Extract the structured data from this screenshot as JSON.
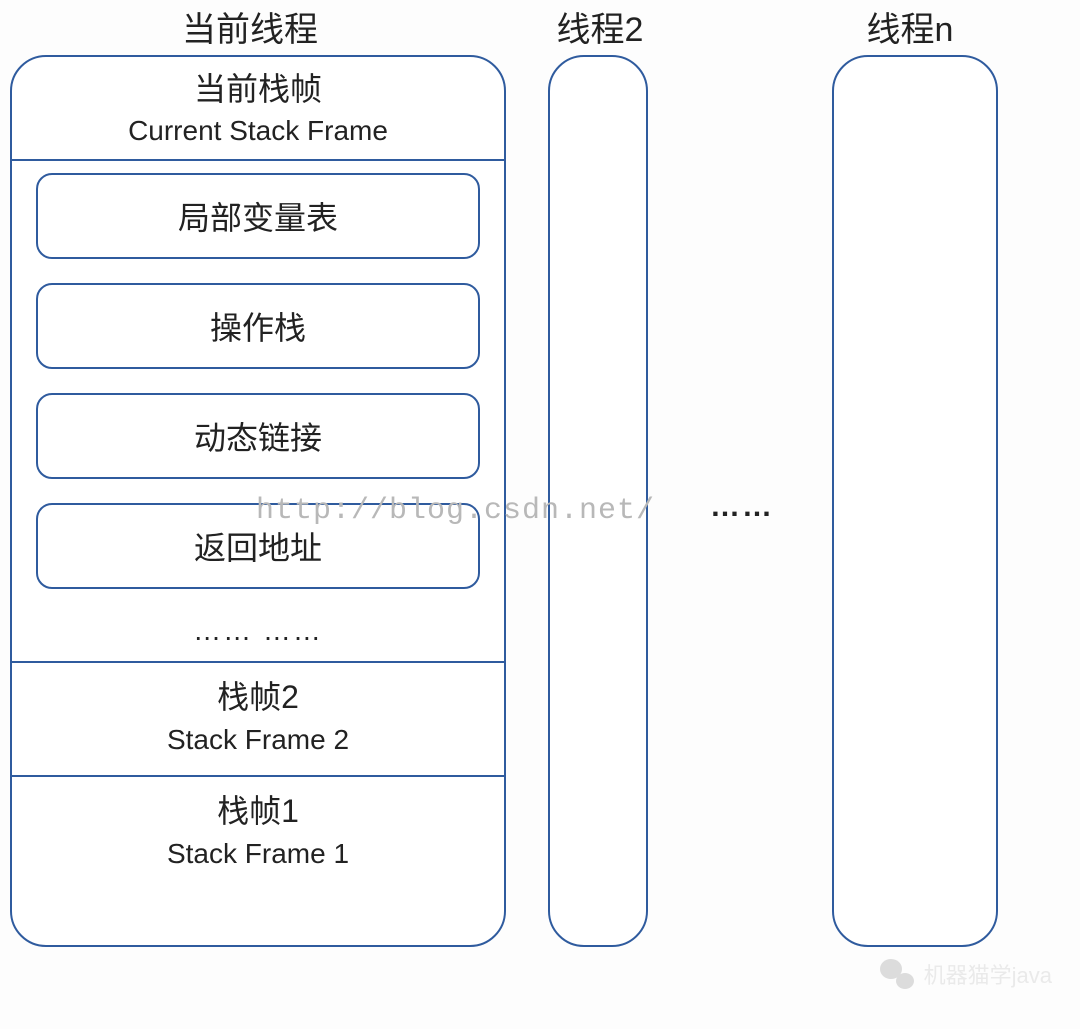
{
  "headers": {
    "thread_current": "当前线程",
    "thread_2": "线程2",
    "thread_n": "线程n"
  },
  "current_frame": {
    "title_cn": "当前栈帧",
    "title_en": "Current Stack Frame",
    "items": {
      "local_vars": "局部变量表",
      "operand_stack": "操作栈",
      "dynamic_link": "动态链接",
      "return_addr": "返回地址"
    },
    "more": "…… ……"
  },
  "frame2": {
    "title_cn": "栈帧2",
    "title_en": "Stack Frame 2"
  },
  "frame1": {
    "title_cn": "栈帧1",
    "title_en": "Stack Frame 1"
  },
  "between": "……",
  "watermark_url": "http://blog.csdn.net/",
  "wechat_label": "机器猫学java"
}
